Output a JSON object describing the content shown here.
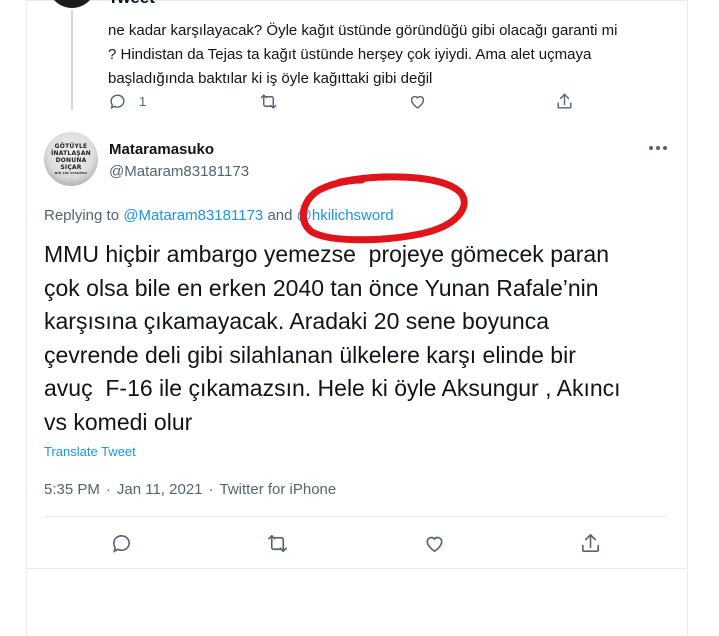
{
  "parent_tweet": {
    "header_fragment": "Tweet",
    "lines": [
      "ne kadar karşılayacak? Öyle kağıt üstünde göründüğü gibi olacağı garanti mi",
      "? Hindistan da Tejas ta kağıt üstünde herşey çok iyiydi. Ama alet uçmaya",
      "başladığında baktılar ki iş öyle kağıttaki gibi değil"
    ],
    "reply_count": "1"
  },
  "tweet": {
    "display_name": "Mataramasuko",
    "handle": "@Mataram83181173",
    "avatar_text": [
      "GÖTÜYLE",
      "İNATLAŞAN",
      "DONUNA",
      "SIÇAR",
      "BİR ÇİN ATASÖZÜ"
    ],
    "replying_prefix": "Replying to",
    "replying_to_1": "@Mataram83181173",
    "replying_and": "and",
    "replying_to_2": "@hkilichsword",
    "body_lines": [
      "MMU hiçbir ambargo yemezse  projeye gömecek paran",
      "çok olsa bile en erken 2040 tan önce Yunan Rafale’nin",
      "karşısına çıkamayacak. Aradaki 20 sene boyunca",
      "çevrende deli gibi silahlanan ülkelere karşı elinde bir",
      "avuç  F-16 ile çıkamazsın. Hele ki öyle Aksungur , Akıncı",
      "vs komedi olur"
    ],
    "translate_label": "Translate Tweet",
    "time": "5:35 PM",
    "date": "Jan 11, 2021",
    "source": "Twitter for iPhone",
    "separator": "·"
  },
  "colors": {
    "link": "#1b95e0",
    "secondary_text": "#536471",
    "annotation": "#e0141b"
  },
  "icons": [
    "reply-icon",
    "retweet-icon",
    "like-icon",
    "share-icon",
    "more-icon"
  ]
}
